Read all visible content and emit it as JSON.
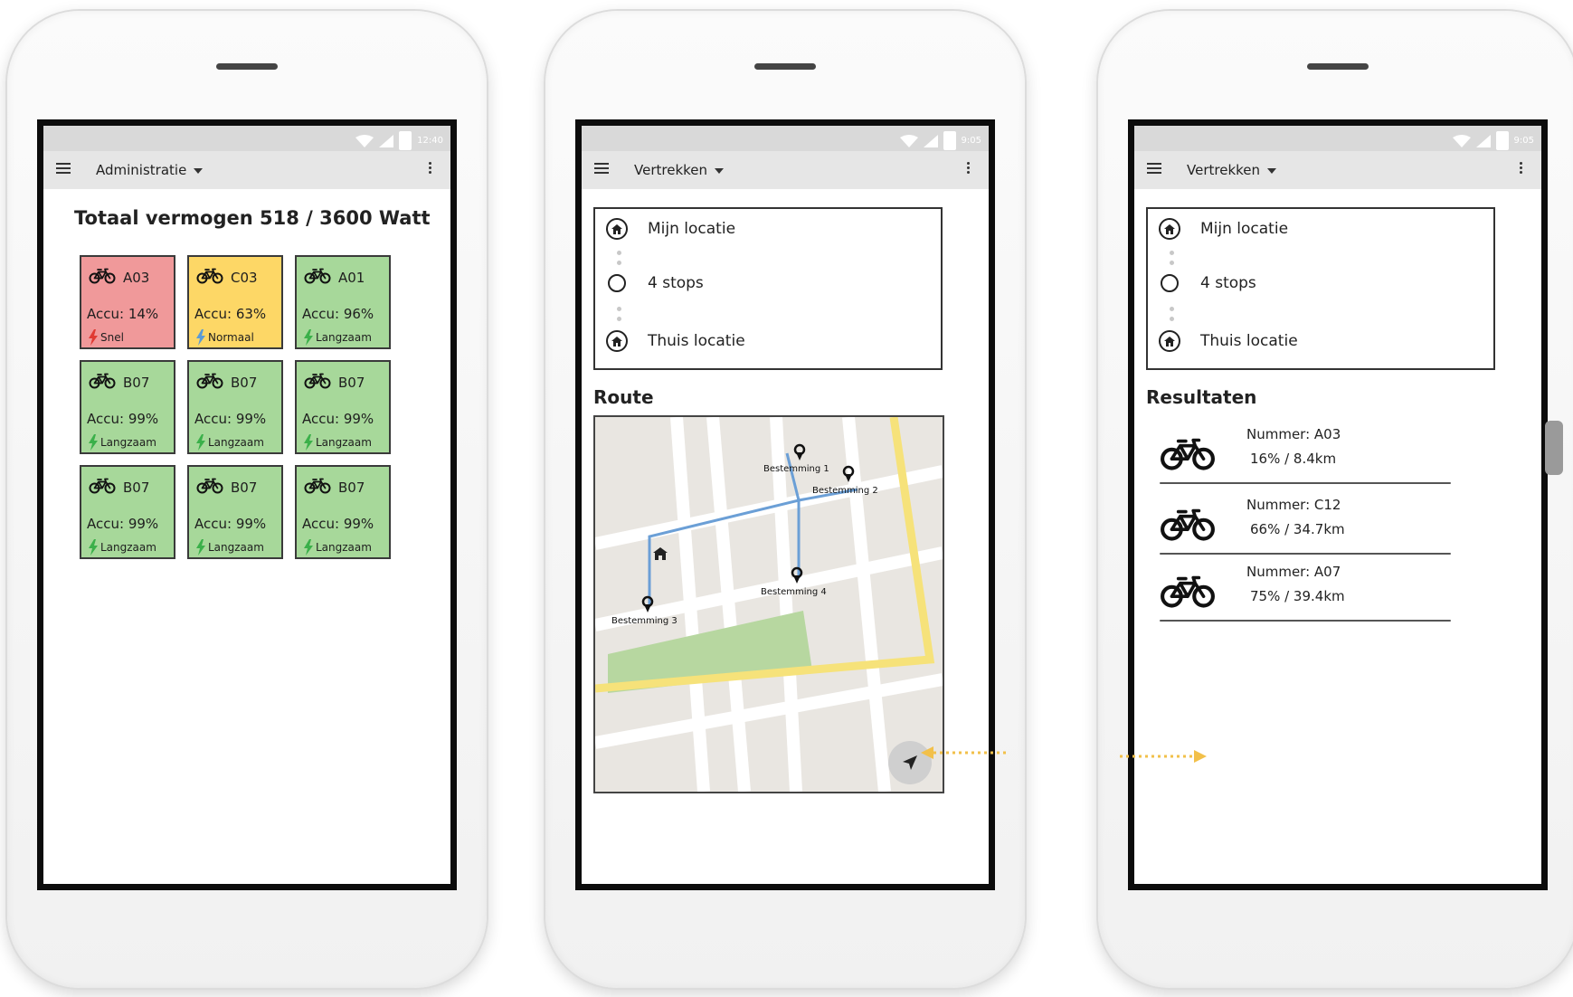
{
  "colors": {
    "red_tile": "#f0999a",
    "yellow_tile": "#fdd766",
    "green_tile": "#a7d89a",
    "bolt_red": "#e03a32",
    "bolt_blue": "#5b9bd5",
    "bolt_green": "#3bb04a",
    "route_blue": "#6b9fd6",
    "road_yellow": "#f6e27a",
    "park_green": "#b7d7a0",
    "arrow_yellow": "#f2c04a"
  },
  "statusbar": {
    "time_1": "12:40",
    "time_2": "9:05",
    "time_3": "9:05"
  },
  "screen1": {
    "menu_title": "Administratie",
    "power_title": "Totaal vermogen 518 / 3600 Watt",
    "tiles": [
      {
        "id": "A03",
        "accu": "Accu: 14%",
        "speed": "Snel",
        "color": "red",
        "bolt": "red"
      },
      {
        "id": "C03",
        "accu": "Accu: 63%",
        "speed": "Normaal",
        "color": "yellow",
        "bolt": "blue"
      },
      {
        "id": "A01",
        "accu": "Accu: 96%",
        "speed": "Langzaam",
        "color": "green",
        "bolt": "green"
      },
      {
        "id": "B07",
        "accu": "Accu: 99%",
        "speed": "Langzaam",
        "color": "green",
        "bolt": "green"
      },
      {
        "id": "B07",
        "accu": "Accu: 99%",
        "speed": "Langzaam",
        "color": "green",
        "bolt": "green"
      },
      {
        "id": "B07",
        "accu": "Accu: 99%",
        "speed": "Langzaam",
        "color": "green",
        "bolt": "green"
      },
      {
        "id": "B07",
        "accu": "Accu: 99%",
        "speed": "Langzaam",
        "color": "green",
        "bolt": "green"
      },
      {
        "id": "B07",
        "accu": "Accu: 99%",
        "speed": "Langzaam",
        "color": "green",
        "bolt": "green"
      },
      {
        "id": "B07",
        "accu": "Accu: 99%",
        "speed": "Langzaam",
        "color": "green",
        "bolt": "green"
      }
    ]
  },
  "screen2": {
    "menu_title": "Vertrekken",
    "stops": {
      "start": "Mijn locatie",
      "middle": "4 stops",
      "end": "Thuis locatie"
    },
    "route_title": "Route",
    "map": {
      "pins": [
        "Bestemming 1",
        "Bestemming 2",
        "Bestemming 3",
        "Bestemming 4"
      ]
    }
  },
  "screen3": {
    "menu_title": "Vertrekken",
    "stops": {
      "start": "Mijn locatie",
      "middle": "4 stops",
      "end": "Thuis locatie"
    },
    "results_title": "Resultaten",
    "results": [
      {
        "number": "Nummer: A03",
        "stat": "16% / 8.4km"
      },
      {
        "number": "Nummer: C12",
        "stat": "66% / 34.7km"
      },
      {
        "number": "Nummer: A07",
        "stat": "75% / 39.4km"
      }
    ]
  }
}
